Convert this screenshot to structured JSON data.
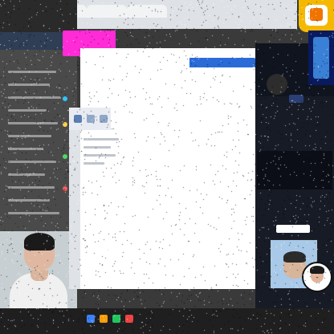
{
  "browser": {
    "tabs": [
      "",
      "",
      "",
      ""
    ]
  },
  "promo_card": {
    "line1": "",
    "line2": ""
  },
  "highlight_labels": [
    {
      "text": "",
      "highlighted": false
    },
    {
      "text": "",
      "highlighted": true
    },
    {
      "text": "",
      "highlighted": false
    }
  ],
  "sidebar": {
    "title": ""
  },
  "stream_panel": {
    "title": "",
    "username": "",
    "section_lines": [
      "",
      "",
      ""
    ],
    "button_label": ""
  },
  "taskbar": {
    "time": ""
  },
  "colors": {
    "accent_blue": "#2a6bd8",
    "magenta": "#ff2bd6",
    "yellow": "#ffe600",
    "stream_bg": "#171b26"
  },
  "icons": {
    "brand": "logo-badge-icon",
    "search": "search-icon",
    "refresh": "refresh-icon"
  }
}
